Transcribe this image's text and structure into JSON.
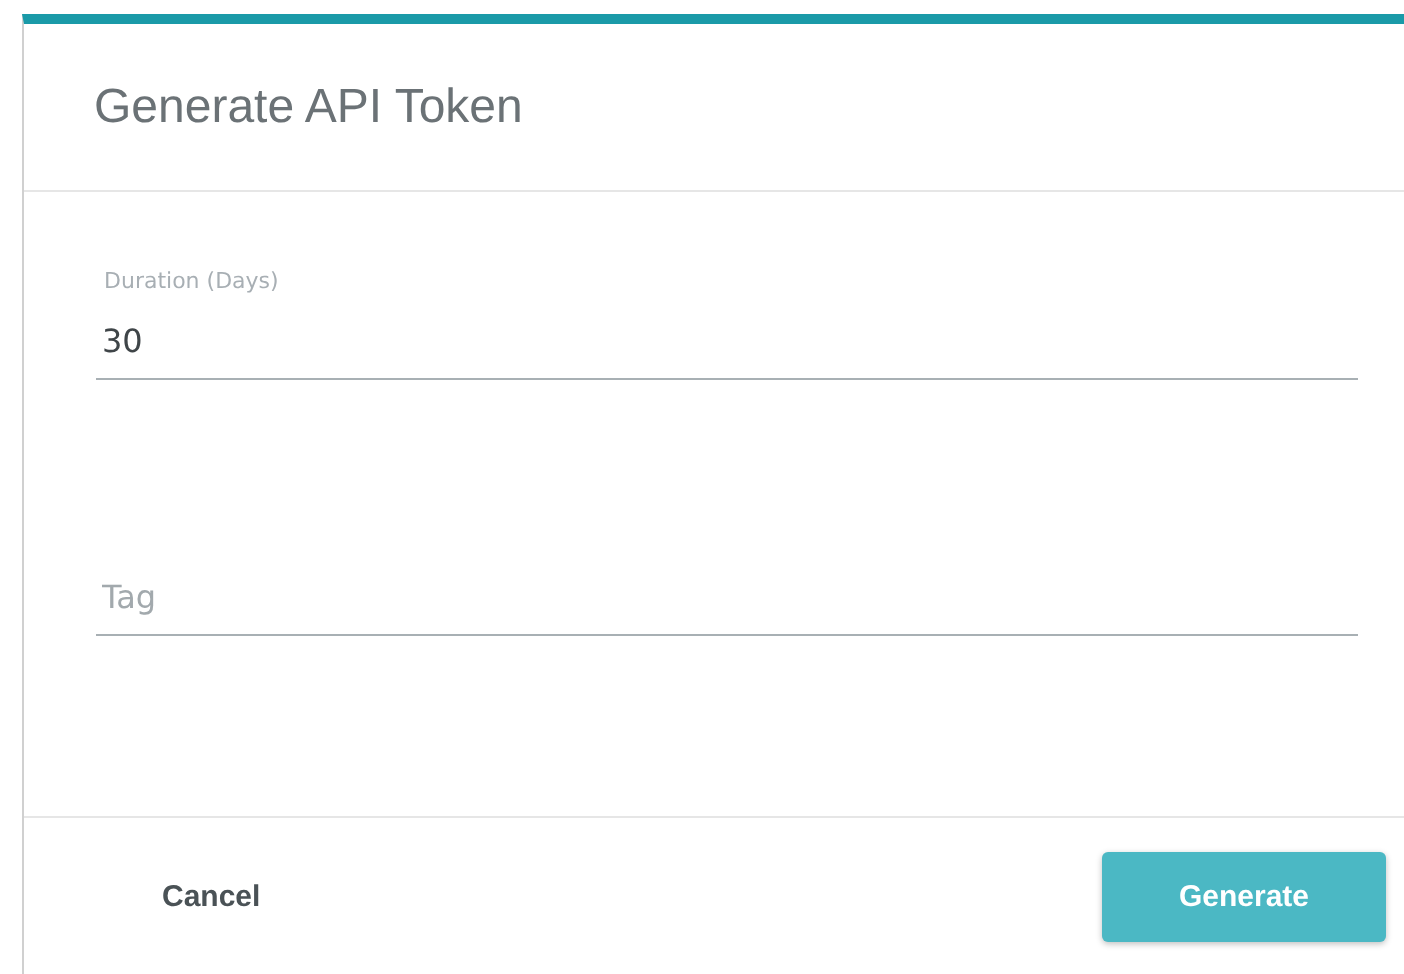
{
  "dialog": {
    "title": "Generate API Token"
  },
  "fields": [
    {
      "label": "Duration (Days)",
      "value": "30"
    },
    {
      "placeholder": "Tag"
    }
  ],
  "buttons": [
    {
      "label": "Cancel",
      "kind": "text"
    },
    {
      "label": "Generate",
      "kind": "primary"
    }
  ]
}
